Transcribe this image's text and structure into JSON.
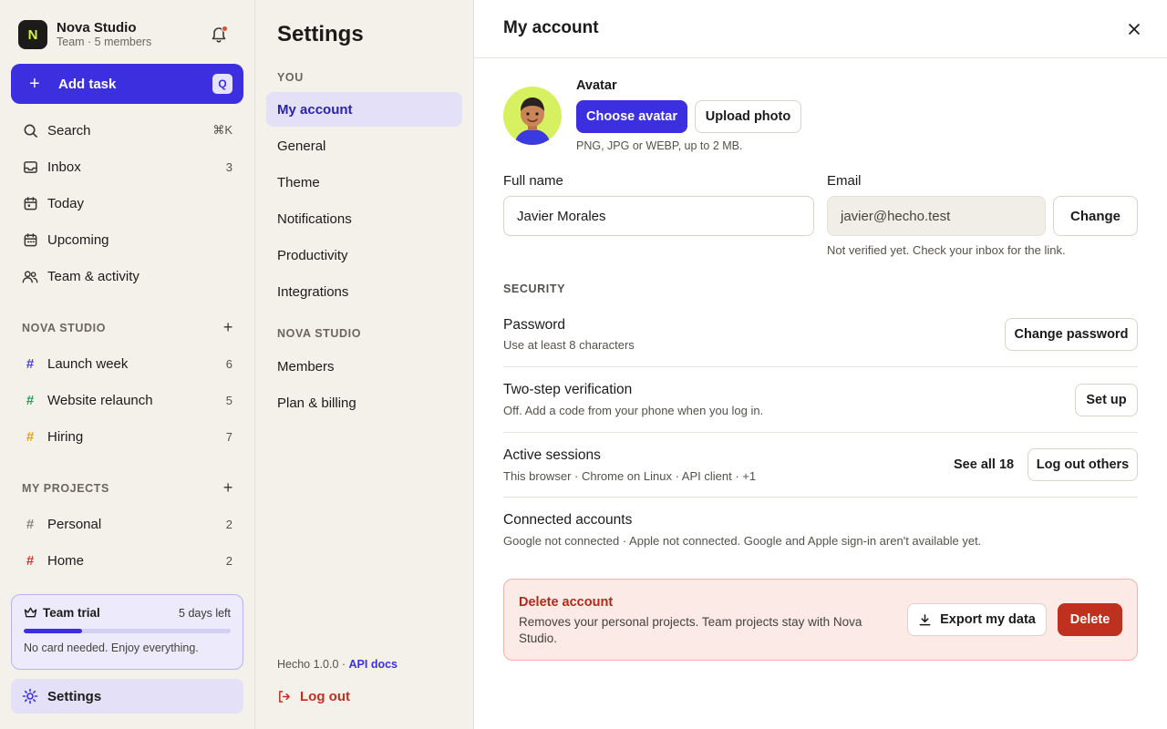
{
  "workspace": {
    "name": "Nova Studio",
    "initial": "N",
    "subtitle": "Team · 5 members"
  },
  "add_task": {
    "label": "Add task",
    "shortcut": "Q"
  },
  "nav": [
    {
      "label": "Search",
      "count": "⌘K",
      "icon": "search-icon"
    },
    {
      "label": "Inbox",
      "count": "3",
      "icon": "inbox-icon"
    },
    {
      "label": "Today",
      "count": "",
      "icon": "calendar-today-icon"
    },
    {
      "label": "Upcoming",
      "count": "",
      "icon": "calendar-upcoming-icon"
    },
    {
      "label": "Team & activity",
      "count": "",
      "icon": "team-icon"
    }
  ],
  "team_section": {
    "title": "NOVA STUDIO",
    "projects": [
      {
        "label": "Launch week",
        "count": "6",
        "color": "#4a3fe0"
      },
      {
        "label": "Website relaunch",
        "count": "5",
        "color": "#2e9a5a"
      },
      {
        "label": "Hiring",
        "count": "7",
        "color": "#e6a21a"
      }
    ]
  },
  "my_section": {
    "title": "MY PROJECTS",
    "projects": [
      {
        "label": "Personal",
        "count": "2",
        "color": "#8a867e"
      },
      {
        "label": "Home",
        "count": "2",
        "color": "#d13b2a"
      }
    ]
  },
  "trial": {
    "title": "Team trial",
    "days_left": "5 days left",
    "note": "No card needed. Enjoy everything.",
    "progress": 0.28
  },
  "sidebar_settings": {
    "label": "Settings"
  },
  "settings": {
    "title": "Settings",
    "you_header": "YOU",
    "you_items": [
      "My account",
      "General",
      "Theme",
      "Notifications",
      "Productivity",
      "Integrations"
    ],
    "team_header": "NOVA STUDIO",
    "team_items": [
      "Members",
      "Plan & billing"
    ],
    "version": "Hecho 1.0.0 · ",
    "api_docs": "API docs",
    "logout": "Log out"
  },
  "account": {
    "title": "My account",
    "avatar_label": "Avatar",
    "choose_avatar": "Choose avatar",
    "upload_photo": "Upload photo",
    "avatar_hint": "PNG, JPG or WEBP, up to 2 MB.",
    "full_name_label": "Full name",
    "full_name_value": "Javier Morales",
    "email_label": "Email",
    "email_value": "javier@hecho.test",
    "change_email": "Change",
    "email_hint": "Not verified yet. Check your inbox for the link.",
    "security_label": "SECURITY",
    "password_title": "Password",
    "password_desc": "Use at least 8 characters",
    "change_password": "Change password",
    "twostep_title": "Two-step verification",
    "twostep_desc": "Off. Add a code from your phone when you log in.",
    "setup": "Set up",
    "sessions_title": "Active sessions",
    "sessions_desc": "This browser · Chrome on Linux · API client · +1",
    "see_all": "See all 18",
    "logout_others": "Log out others",
    "connected_title": "Connected accounts",
    "connected_desc": "Google not connected · Apple not connected. Google and Apple sign-in aren't available yet.",
    "delete_title": "Delete account",
    "delete_desc": "Removes your personal projects. Team projects stay with Nova Studio.",
    "export": "Export my data",
    "delete": "Delete"
  }
}
